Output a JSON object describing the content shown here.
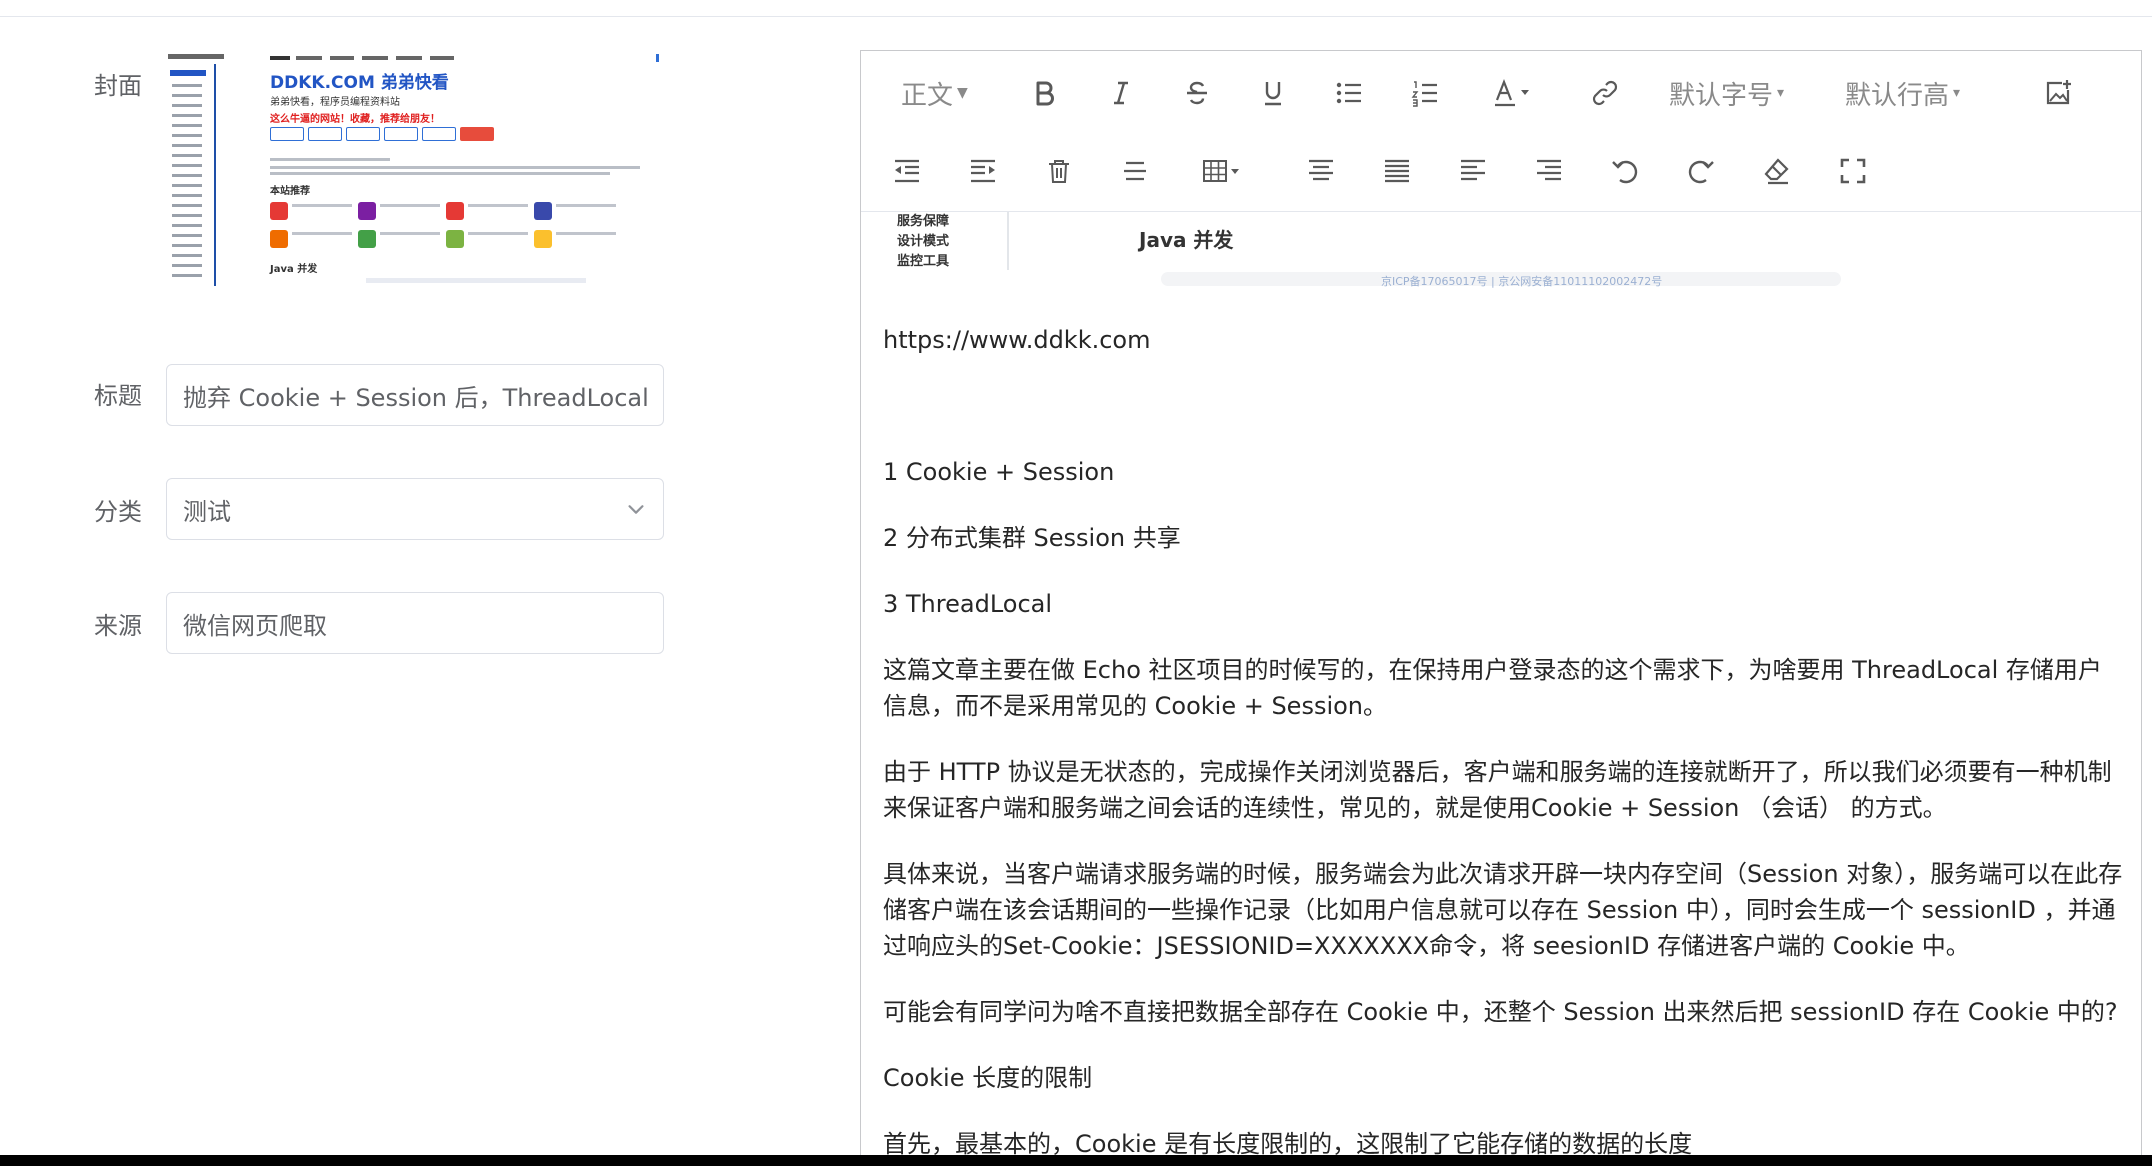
{
  "form": {
    "cover_label": "封面",
    "title_label": "标题",
    "title_value": "抛弃 Cookie + Session 后，ThreadLocal 独领",
    "category_label": "分类",
    "category_value": "测试",
    "source_label": "来源",
    "source_value": "微信网页爬取"
  },
  "cover": {
    "title": "DDKK.COM 弟弟快看",
    "subtitle": "弟弟快看，程序员编程资料站",
    "notice": "这么牛逼的网站！收藏，推荐给朋友！",
    "section_recommend": "本站推荐",
    "section_java": "Java 并发"
  },
  "toolbar": {
    "paragraph_label": "正文",
    "font_size_label": "默认字号",
    "line_height_label": "默认行高"
  },
  "embed": {
    "sidebar_items": [
      "服务保障",
      "设计模式",
      "监控工具"
    ],
    "section_title": "Java 并发",
    "footer_text": "京ICP备17065017号 | 京公网安备11011102002472号"
  },
  "article": {
    "url": "https://www.ddkk.com",
    "toc_1": "1 Cookie + Session",
    "toc_2": "2 分布式集群 Session 共享",
    "toc_3": "3 ThreadLocal",
    "p1": "这篇文章主要在做 Echo 社区项目的时候写的，在保持用户登录态的这个需求下，为啥要用 ThreadLocal 存储用户信息，而不是采用常见的 Cookie + Session。",
    "p2": "由于 HTTP 协议是无状态的，完成操作关闭浏览器后，客户端和服务端的连接就断开了，所以我们必须要有一种机制来保证客户端和服务端之间会话的连续性，常见的，就是使用Cookie + Session （会话） 的方式。",
    "p3": "具体来说，当客户端请求服务端的时候，服务端会为此次请求开辟一块内存空间（Session 对象），服务端可以在此存储客户端在该会话期间的一些操作记录（比如用户信息就可以存在 Session 中），同时会生成一个 sessionID ，并通过响应头的Set-Cookie：JSESSIONID=XXXXXXX命令，将 seesionID 存储进客户端的 Cookie 中。",
    "p4": "可能会有同学问为啥不直接把数据全部存在 Cookie 中，还整个 Session 出来然后把 sessionID 存在 Cookie 中的?",
    "p5": "Cookie 长度的限制",
    "p6": "首先，最基本的，Cookie 是有长度限制的，这限制了它能存储的数据的长度"
  }
}
